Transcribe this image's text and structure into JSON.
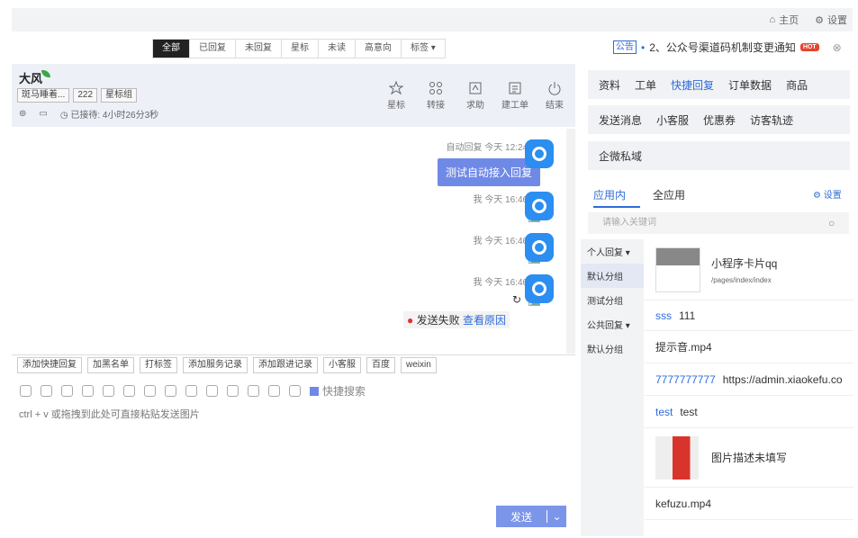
{
  "nav": {
    "home": "主页",
    "settings": "设置"
  },
  "filters": [
    "全部",
    "已回复",
    "未回复",
    "星标",
    "未读",
    "高意向",
    "标签 ▾"
  ],
  "notice": {
    "tag": "公告",
    "bullet": "•",
    "text": "2、公众号渠道码机制变更通知",
    "hot": "HOT"
  },
  "customer": {
    "name": "大风",
    "tags": [
      "斑马睡着...",
      "222",
      "星标组"
    ],
    "wait": "已接待: 4小时26分3秒"
  },
  "actions": [
    "星标",
    "转接",
    "求助",
    "建工单",
    "结束"
  ],
  "messages": [
    {
      "sender": "自动回复",
      "time": "今天 12:24:31",
      "text": "测试自动接入回复"
    },
    {
      "sender": "我",
      "time": "今天 16:46:24"
    },
    {
      "sender": "我",
      "time": "今天 16:46:25"
    },
    {
      "sender": "我",
      "time": "今天 16:46:26"
    }
  ],
  "fail": {
    "text": "发送失败",
    "link": "查看原因"
  },
  "toolbar": [
    "添加快捷回复",
    "加黑名单",
    "打标签",
    "添加服务记录",
    "添加跟进记录",
    "小客服",
    "百度",
    "weixin"
  ],
  "quick_search": "快捷搜索",
  "input_hint": "ctrl + v 或拖拽到此处可直接粘贴发送图片",
  "send": "发送",
  "right": {
    "tabs1": [
      "资料",
      "工单",
      "快捷回复",
      "订单数据",
      "商品"
    ],
    "tabs2": [
      "发送消息",
      "小客服",
      "优惠券",
      "访客轨迹"
    ],
    "tabs3": [
      "企微私域"
    ],
    "subtabs": [
      "应用内",
      "全应用"
    ],
    "settings": "设置",
    "search_placeholder": "请输入关键词",
    "groups": [
      "个人回复 ▾",
      "默认分组",
      "测试分组",
      "公共回复 ▾",
      "默认分组"
    ],
    "items": [
      {
        "title": "小程序卡片qq",
        "sub": "/pages/index/index"
      },
      {
        "key": "sss",
        "val": "111"
      },
      {
        "val": "提示音.mp4"
      },
      {
        "key": "7777777777",
        "val": "https://admin.xiaokefu.co..."
      },
      {
        "key": "test",
        "val": "test"
      },
      {
        "val": "图片描述未填写"
      },
      {
        "val": "kefuzu.mp4"
      }
    ]
  }
}
